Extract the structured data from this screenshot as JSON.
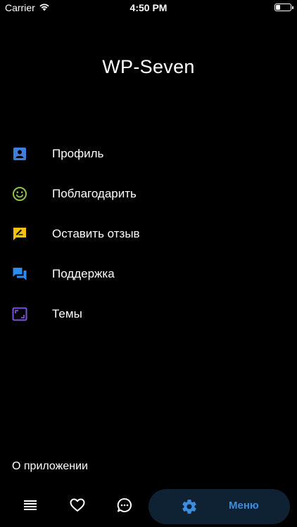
{
  "status_bar": {
    "carrier": "Carrier",
    "time": "4:50 PM",
    "wifi_icon": "wifi-icon",
    "battery_icon": "battery-icon",
    "battery_level": 0.3
  },
  "header": {
    "title": "WP-Seven"
  },
  "menu": {
    "items": [
      {
        "label": "Профиль",
        "icon": "profile-icon",
        "color": "#3d7fe0"
      },
      {
        "label": "Поблагодарить",
        "icon": "smiley-icon",
        "color": "#8bc34a"
      },
      {
        "label": "Оставить отзыв",
        "icon": "feedback-edit-icon",
        "color": "#f4c20d"
      },
      {
        "label": "Поддержка",
        "icon": "chat-support-icon",
        "color": "#2d8cf0"
      },
      {
        "label": "Темы",
        "icon": "theme-frame-icon",
        "color": "#7b52d9"
      }
    ]
  },
  "footer": {
    "about_label": "О приложении"
  },
  "bottom_nav": {
    "items": [
      {
        "icon": "list-icon"
      },
      {
        "icon": "heart-icon"
      },
      {
        "icon": "chat-bubble-icon"
      }
    ],
    "active": {
      "icon": "gear-icon",
      "label": "Меню",
      "color": "#3a8ddf",
      "background": "#0f2234"
    }
  }
}
